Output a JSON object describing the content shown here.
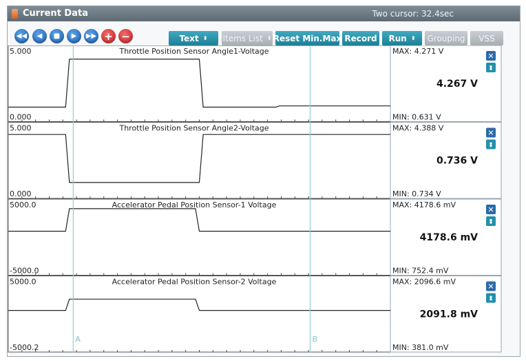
{
  "window": {
    "title": "Current Data",
    "cursor_status": "Two cursor: 32.4sec"
  },
  "toolbar": {
    "buttons": [
      {
        "name": "rewind-button",
        "icon": "rewind-icon",
        "glyph": "◀◀",
        "color": "blue"
      },
      {
        "name": "prev-button",
        "icon": "prev-icon",
        "glyph": "◀",
        "color": "blue"
      },
      {
        "name": "stop-button",
        "icon": "stop-icon",
        "glyph": "■",
        "color": "blue"
      },
      {
        "name": "play-button",
        "icon": "play-icon",
        "glyph": "▶",
        "color": "blue"
      },
      {
        "name": "fast-forward-button",
        "icon": "fast-forward-icon",
        "glyph": "▶▶",
        "color": "blue"
      },
      {
        "name": "zoom-in-button",
        "icon": "plus-icon",
        "glyph": "+",
        "color": "red"
      },
      {
        "name": "zoom-out-button",
        "icon": "minus-icon",
        "glyph": "−",
        "color": "red"
      }
    ],
    "text_select": "Text",
    "items_list": "Items List",
    "reset_minmax": "Reset Min.Max",
    "record": "Record",
    "run": "Run",
    "grouping": "Grouping",
    "vss": "VSS",
    "select_arrow": "⬍"
  },
  "cursors": {
    "a_label": "A",
    "b_label": "B",
    "a_time": 0.17,
    "b_time": 0.79
  },
  "panel_icons": {
    "close_glyph": "✕",
    "expand_glyph": "⬍"
  },
  "colors": {
    "trace": "#222222",
    "cursor_line": "#8fd0d6",
    "close_button": "#2c6aa8",
    "teal_button": "#2290ab",
    "title_bar": "#6e7b85"
  },
  "chart_data": [
    {
      "type": "line",
      "title": "Throttle Position Sensor Angle1-Voltage",
      "y_top_label": "5.000",
      "y_bottom_label": "0.000",
      "ylim": [
        0,
        5
      ],
      "max_label": "MAX: 4.271 V",
      "min_label": "MIN: 0.631 V",
      "current_value": "4.267 V",
      "x": [
        0,
        0.15,
        0.16,
        0.5,
        0.51,
        0.7,
        0.71,
        1.0
      ],
      "y": [
        0.63,
        0.63,
        4.27,
        4.27,
        0.63,
        0.63,
        0.72,
        0.72
      ]
    },
    {
      "type": "line",
      "title": "Throttle Position Sensor Angle2-Voltage",
      "y_top_label": "5.000",
      "y_bottom_label": "0.000",
      "ylim": [
        0,
        5
      ],
      "max_label": "MAX: 4.388 V",
      "min_label": "MIN: 0.734 V",
      "current_value": "0.736 V",
      "x": [
        0,
        0.15,
        0.16,
        0.5,
        0.51,
        0.6,
        1.0
      ],
      "y": [
        4.39,
        4.39,
        0.74,
        0.74,
        4.39,
        4.39,
        4.39
      ]
    },
    {
      "type": "line",
      "title": "Accelerator Pedal Position Sensor-1 Voltage",
      "y_top_label": "5000.0",
      "y_bottom_label": "-5000.0",
      "ylim": [
        -5000,
        5000
      ],
      "max_label": "MAX: 4178.6 mV",
      "min_label": "MIN: 752.4 mV",
      "current_value": "4178.6 mV",
      "x": [
        0,
        0.15,
        0.16,
        0.49,
        0.5,
        0.88,
        1.0
      ],
      "y": [
        752,
        752,
        4178,
        4178,
        752,
        752,
        752
      ]
    },
    {
      "type": "line",
      "title": "Accelerator Pedal Position Sensor-2 Voltage",
      "y_top_label": "5000.0",
      "y_bottom_label": "-5000.2",
      "ylim": [
        -5000,
        5000
      ],
      "max_label": "MAX: 2096.6 mV",
      "min_label": "MIN: 381.0 mV",
      "current_value": "2091.8 mV",
      "x": [
        0,
        0.15,
        0.16,
        0.49,
        0.5,
        1.0
      ],
      "y": [
        381,
        381,
        2096,
        2096,
        381,
        381
      ]
    }
  ]
}
